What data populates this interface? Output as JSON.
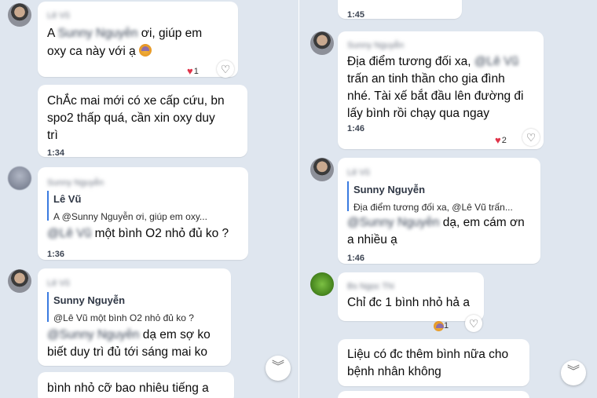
{
  "left": {
    "m1": {
      "sender": "Lê Vũ",
      "text_a": "A",
      "mention": "Sunny Nguyễn",
      "text_b": "ơi, giúp em",
      "line2": "oxy ca này với ạ",
      "emoji": "😥",
      "reaction_count": "1"
    },
    "m2": {
      "line1": "ChẮc mai mới có xe cấp cứu, bn",
      "line2": "spo2 thấp quá, cần xin oxy duy",
      "line3": "trì",
      "time": "1:34"
    },
    "m3": {
      "sender": "Sunny Nguyễn",
      "quote_name": "Lê Vũ",
      "quote_text": "A @Sunny Nguyễn ơi, giúp em oxy...",
      "mention": "@Lê Vũ",
      "text": "một bình O2 nhỏ đủ ko ?",
      "time": "1:36"
    },
    "m4": {
      "sender": "Lê Vũ",
      "quote_name": "Sunny Nguyễn",
      "quote_text": "@Lê Vũ một bình O2 nhỏ đủ ko ?",
      "mention": "@Sunny Nguyễn",
      "text_a": "dạ em sợ ko",
      "line2": "biết duy trì đủ tới sáng mai ko"
    },
    "m5": {
      "line1": "bình nhỏ cỡ bao nhiêu tiếng a"
    }
  },
  "right": {
    "m0": {
      "time": "1:45"
    },
    "m1": {
      "sender": "Sunny Nguyễn",
      "line1": "Địa điểm tương đối xa,",
      "mention": "@Lê Vũ",
      "line2": "trấn an tinh thần cho gia đình",
      "line3": "nhé. Tài xế bắt đầu lên đường đi",
      "line4": "lấy bình rồi chạy qua ngay",
      "time": "1:46",
      "reaction_count": "2"
    },
    "m2": {
      "sender": "Lê Vũ",
      "quote_name": "Sunny Nguyễn",
      "quote_text": "Địa điểm tương đối xa, @Lê Vũ trấn...",
      "mention": "@Sunny Nguyễn",
      "text": "dạ, em cám ơn",
      "line2": "a nhiều ạ",
      "time": "1:46"
    },
    "m3": {
      "sender": "Bs Ngọc Thi",
      "line1": "Chỉ đc 1 bình nhỏ hả a",
      "reaction_count": "1"
    },
    "m4": {
      "line1": "Liệu có đc thêm bình nữa cho",
      "line2": "bệnh nhân không"
    }
  },
  "icons": {
    "heart": "♥",
    "like": "♡",
    "scroll_down": "︾"
  }
}
